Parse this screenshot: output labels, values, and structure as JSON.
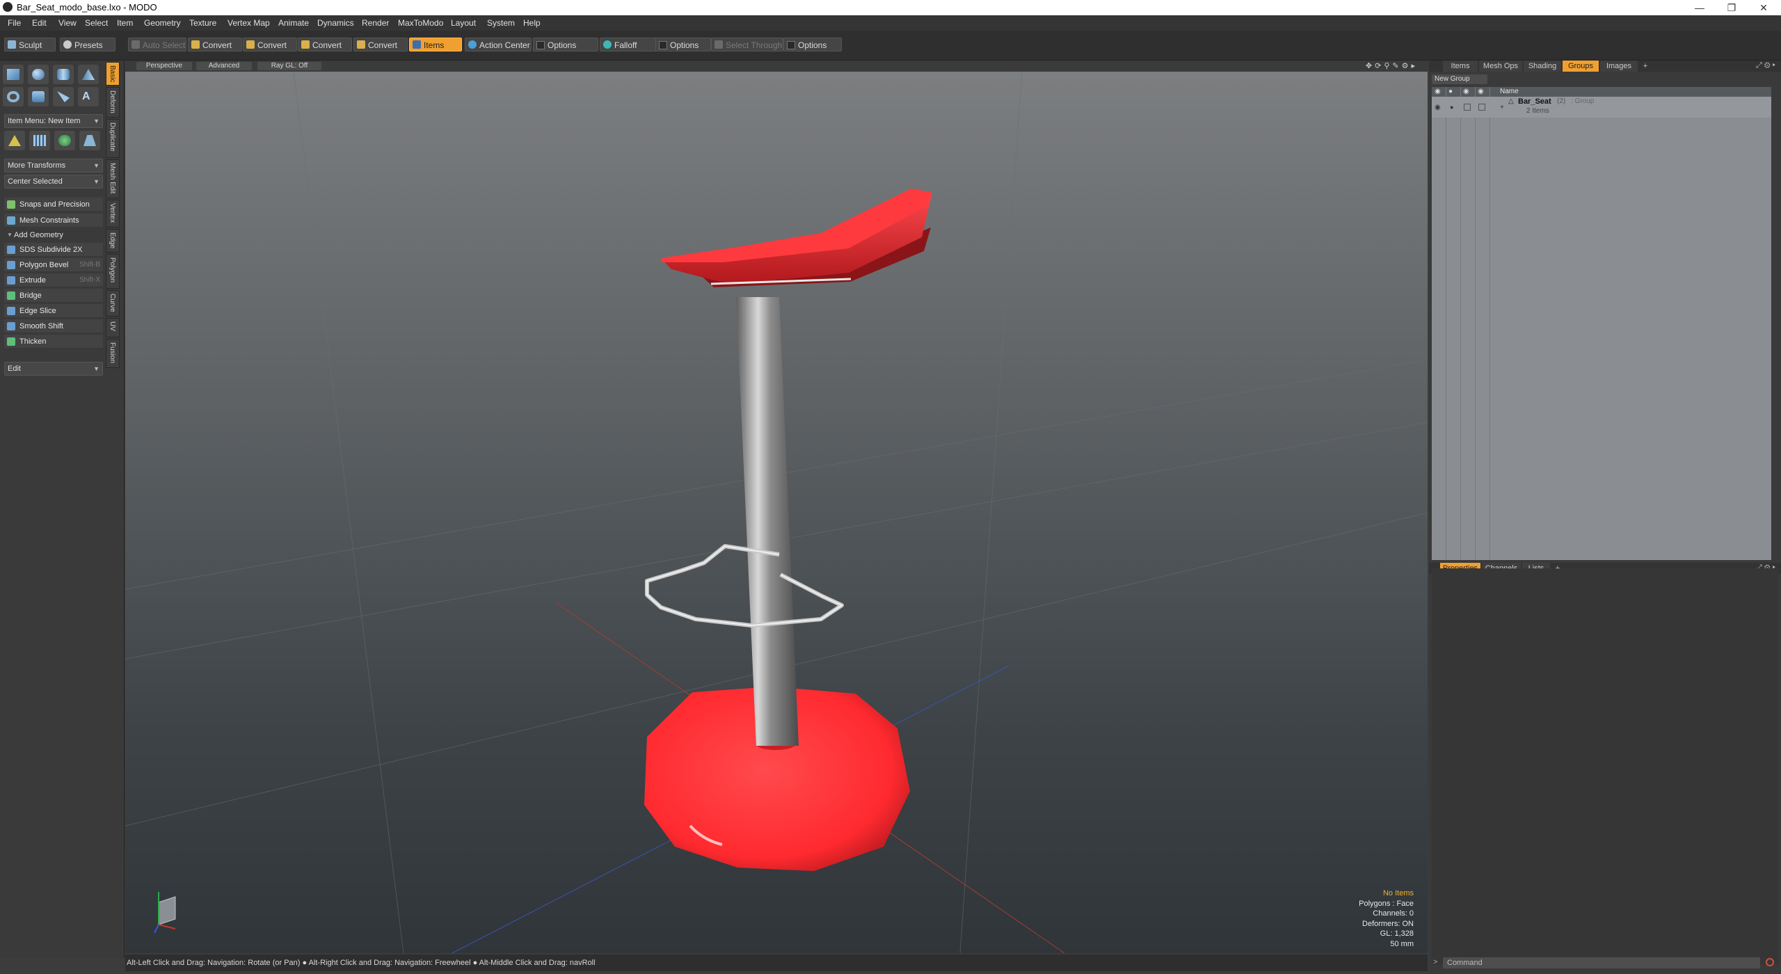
{
  "window": {
    "title": "Bar_Seat_modo_base.lxo - MODO",
    "controls": [
      "minimize-icon",
      "restore-icon",
      "close-icon"
    ]
  },
  "menu": [
    "File",
    "Edit",
    "View",
    "Select",
    "Item",
    "Geometry",
    "Texture",
    "Vertex Map",
    "Animate",
    "Dynamics",
    "Render",
    "MaxToModo",
    "Layout",
    "System",
    "Help"
  ],
  "toolbar": {
    "sculpt": "Sculpt",
    "presets": "Presets",
    "auto_select": "Auto Select",
    "convert1": "Convert",
    "convert2": "Convert",
    "convert3": "Convert",
    "convert4": "Convert",
    "items": "Items",
    "action_center": "Action Center",
    "options1": "Options",
    "falloff": "Falloff",
    "options2": "Options",
    "select_through": "Select Through",
    "options3": "Options"
  },
  "left": {
    "item_menu": "Item Menu: New Item",
    "more_transforms": "More Transforms",
    "center_selected": "Center Selected",
    "snaps": "Snaps and Precision",
    "mesh_constraints": "Mesh Constraints",
    "add_geometry": "Add Geometry",
    "tools": [
      {
        "label": "SDS Subdivide 2X",
        "shortcut": ""
      },
      {
        "label": "Polygon Bevel",
        "shortcut": "Shift-B"
      },
      {
        "label": "Extrude",
        "shortcut": "Shift-X"
      },
      {
        "label": "Bridge",
        "shortcut": ""
      },
      {
        "label": "Edge Slice",
        "shortcut": ""
      },
      {
        "label": "Smooth Shift",
        "shortcut": ""
      },
      {
        "label": "Thicken",
        "shortcut": ""
      }
    ],
    "edit": "Edit",
    "vtabs": [
      "Basic",
      "Deform",
      "Duplicate",
      "Mesh Edit",
      "Vertex",
      "Edge",
      "Polygon",
      "Curve",
      "UV",
      "Fusion"
    ]
  },
  "viewport": {
    "view": "Perspective",
    "shading": "Advanced",
    "raygl": "Ray GL: Off",
    "stats": {
      "items": "No Items",
      "polygons": "Polygons : Face",
      "channels": "Channels: 0",
      "deformers": "Deformers: ON",
      "gl": "GL: 1,328",
      "size": "50 mm"
    }
  },
  "status": "Alt-Left Click and Drag: Navigation: Rotate (or Pan) ●  Alt-Right Click and Drag: Navigation: Freewheel ●  Alt-Middle Click and Drag: navRoll",
  "right": {
    "tabs": [
      "Items",
      "Mesh Ops",
      "Shading",
      "Groups",
      "Images",
      "+"
    ],
    "new_group": "New Group",
    "name_header": "Name",
    "group_name": "Bar_Seat",
    "group_count": "(2)",
    "group_type": ": Group",
    "group_items": "2 Items",
    "bottom_tabs": [
      "Properties",
      "Channels",
      "Lists",
      "+"
    ],
    "command_placeholder": "Command"
  },
  "colors": {
    "accent": "#f0a030",
    "seat": "#e8262b",
    "chrome": "#b8b8b8"
  }
}
